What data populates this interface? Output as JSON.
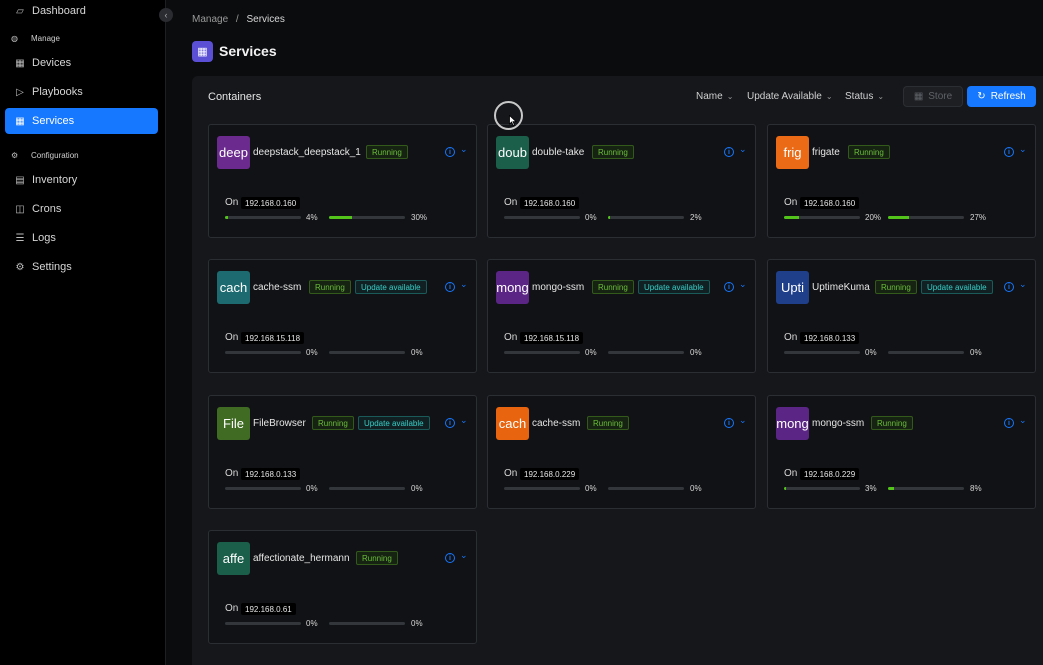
{
  "sidebar": {
    "collapse_icon": "chevron-left-icon",
    "items": [
      {
        "label": "Dashboard",
        "icon": "dashboard-icon",
        "glyph": "▱"
      },
      {
        "group": "Manage",
        "icon": "globe-icon",
        "glyph": "◍"
      },
      {
        "label": "Devices",
        "icon": "table-icon",
        "glyph": "▦"
      },
      {
        "label": "Playbooks",
        "icon": "play-square-icon",
        "glyph": "▷"
      },
      {
        "label": "Services",
        "icon": "appstore-icon",
        "glyph": "▦",
        "active": true
      },
      {
        "group": "Configuration",
        "icon": "settings-icon",
        "glyph": "⚙"
      },
      {
        "label": "Inventory",
        "icon": "database-icon",
        "glyph": "▤"
      },
      {
        "label": "Crons",
        "icon": "field-time-icon",
        "glyph": "◫"
      },
      {
        "label": "Logs",
        "icon": "unordered-list-icon",
        "glyph": "☰"
      },
      {
        "label": "Settings",
        "icon": "setting-icon",
        "glyph": "⚙"
      }
    ]
  },
  "breadcrumb": {
    "parent": "Manage",
    "separator": "/",
    "current": "Services"
  },
  "page": {
    "title": "Services",
    "icon": "appstore-icon"
  },
  "toolbar": {
    "title": "Containers",
    "filters": [
      "Name",
      "Update Available",
      "Status"
    ],
    "store_label": "Store",
    "refresh_label": "Refresh"
  },
  "colors": {
    "accent": "#1677ff",
    "running": "#6abe39",
    "update": "#36cfc9",
    "bar_fill": "#52c41a"
  },
  "containers": [
    {
      "avatar": "deep",
      "avatar_color": "#6b2a8e",
      "name": "deepstack_deepstack_1",
      "status": "Running",
      "update": "",
      "on": "On",
      "ip": "192.168.0.160",
      "cpu": "4%",
      "cpu_value": 4,
      "mem": "30%",
      "mem_value": 30
    },
    {
      "avatar": "doub",
      "avatar_color": "#1b5e4a",
      "name": "double-take",
      "status": "Running",
      "update": "",
      "on": "On",
      "ip": "192.168.0.160",
      "cpu": "0%",
      "cpu_value": 0,
      "mem": "2%",
      "mem_value": 2
    },
    {
      "avatar": "frig",
      "avatar_color": "#ea6a16",
      "name": "frigate",
      "status": "Running",
      "update": "",
      "on": "On",
      "ip": "192.168.0.160",
      "cpu": "20%",
      "cpu_value": 20,
      "mem": "27%",
      "mem_value": 27
    },
    {
      "avatar": "cach",
      "avatar_color": "#1d6b70",
      "name": "cache-ssm",
      "status": "Running",
      "update": "Update available",
      "on": "On",
      "ip": "192.168.15.118",
      "cpu": "0%",
      "cpu_value": 0,
      "mem": "0%",
      "mem_value": 0
    },
    {
      "avatar": "mong",
      "avatar_color": "#5b2585",
      "name": "mongo-ssm",
      "status": "Running",
      "update": "Update available",
      "on": "On",
      "ip": "192.168.15.118",
      "cpu": "0%",
      "cpu_value": 0,
      "mem": "0%",
      "mem_value": 0
    },
    {
      "avatar": "Upti",
      "avatar_color": "#1f3f8a",
      "name": "UptimeKuma",
      "status": "Running",
      "update": "Update available",
      "on": "On",
      "ip": "192.168.0.133",
      "cpu": "0%",
      "cpu_value": 0,
      "mem": "0%",
      "mem_value": 0
    },
    {
      "avatar": "File",
      "avatar_color": "#3f6b23",
      "name": "FileBrowser",
      "status": "Running",
      "update": "Update available",
      "on": "On",
      "ip": "192.168.0.133",
      "cpu": "0%",
      "cpu_value": 0,
      "mem": "0%",
      "mem_value": 0
    },
    {
      "avatar": "cach",
      "avatar_color": "#e8640f",
      "name": "cache-ssm",
      "status": "Running",
      "update": "",
      "on": "On",
      "ip": "192.168.0.229",
      "cpu": "0%",
      "cpu_value": 0,
      "mem": "0%",
      "mem_value": 0
    },
    {
      "avatar": "mong",
      "avatar_color": "#5b2585",
      "name": "mongo-ssm",
      "status": "Running",
      "update": "",
      "on": "On",
      "ip": "192.168.0.229",
      "cpu": "3%",
      "cpu_value": 3,
      "mem": "8%",
      "mem_value": 8
    },
    {
      "avatar": "affe",
      "avatar_color": "#1b5e4a",
      "name": "affectionate_hermann",
      "status": "Running",
      "update": "",
      "on": "On",
      "ip": "192.168.0.61",
      "cpu": "0%",
      "cpu_value": 0,
      "mem": "0%",
      "mem_value": 0
    }
  ]
}
